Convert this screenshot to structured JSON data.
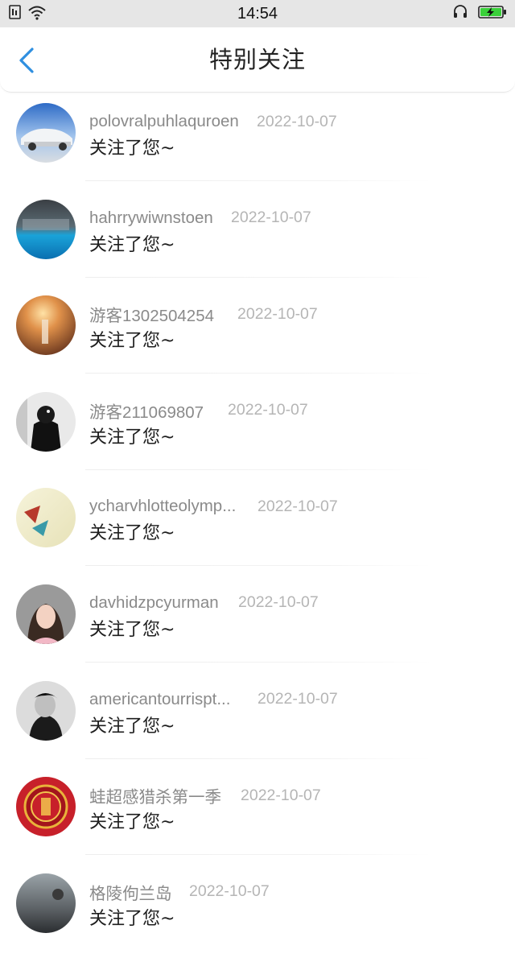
{
  "status_bar": {
    "time": "14:54",
    "icons": [
      "sim-card-icon",
      "wifi-icon",
      "headset-icon",
      "battery-charging-icon"
    ]
  },
  "header": {
    "back_icon": "chevron-left-icon",
    "title": "特别关注"
  },
  "accent_color": "#2f8fe0",
  "followers": [
    {
      "username": "polovralpuhlaquroen",
      "date": "2022-10-07",
      "message": "关注了您~",
      "avatar": "car-photo"
    },
    {
      "username": "hahrrywiwnstoen",
      "date": "2022-10-07",
      "message": "关注了您~",
      "avatar": "ocean-photo"
    },
    {
      "username": "游客1302504254",
      "date": "2022-10-07",
      "message": "关注了您~",
      "avatar": "sunset-photo"
    },
    {
      "username": "游客211069807",
      "date": "2022-10-07",
      "message": "关注了您~",
      "avatar": "person-dark-photo"
    },
    {
      "username": "ycharvhlotteolymp...",
      "date": "2022-10-07",
      "message": "关注了您~",
      "avatar": "paper-crane-photo"
    },
    {
      "username": "davhidzpcyurman",
      "date": "2022-10-07",
      "message": "关注了您~",
      "avatar": "girl-photo"
    },
    {
      "username": "americantourrispt...",
      "date": "2022-10-07",
      "message": "关注了您~",
      "avatar": "bw-portrait-photo"
    },
    {
      "username": "蛙超感猎杀第一季",
      "date": "2022-10-07",
      "message": "关注了您~",
      "avatar": "red-seal-photo"
    },
    {
      "username": "格陵佝兰岛",
      "date": "2022-10-07",
      "message": "关注了您~",
      "avatar": "dusk-photo"
    }
  ]
}
